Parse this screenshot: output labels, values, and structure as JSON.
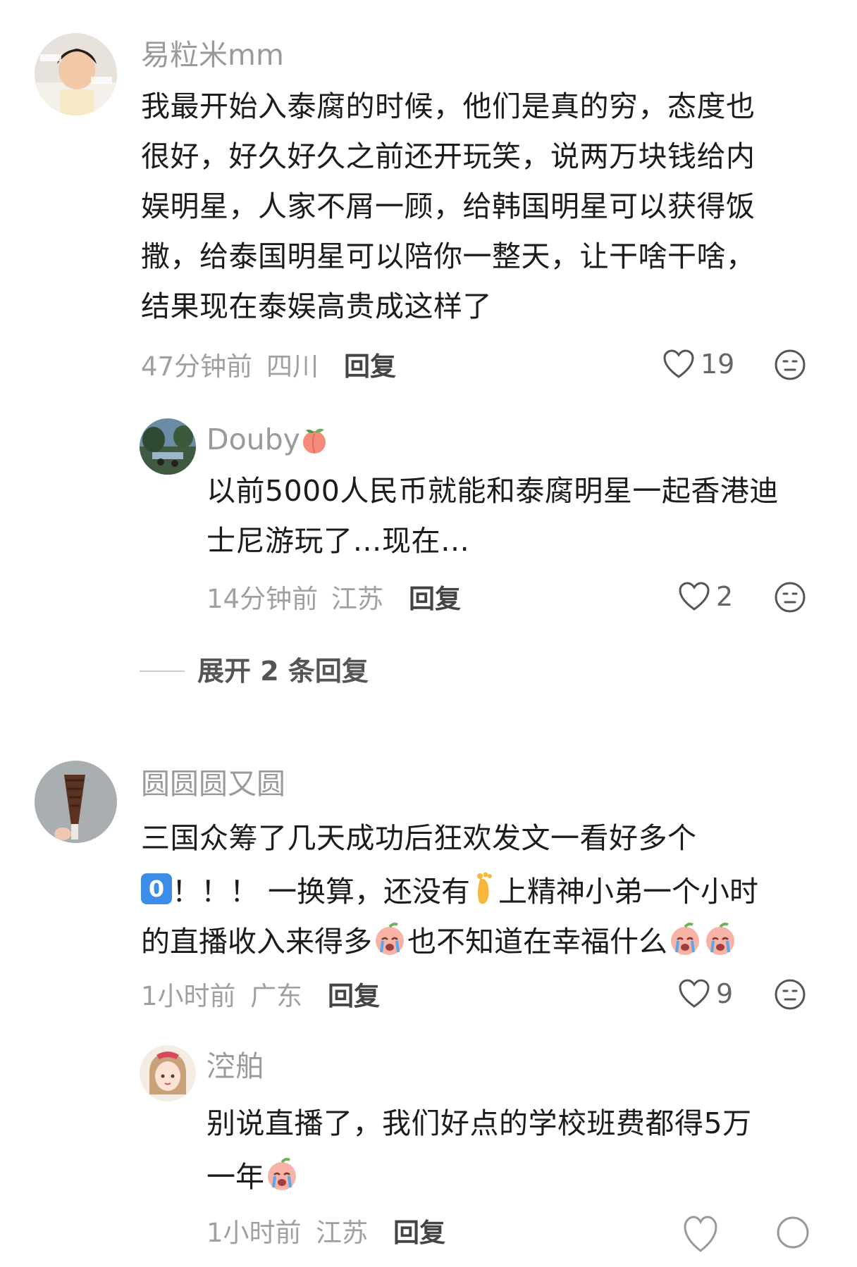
{
  "comments": [
    {
      "username": "易粒米mm",
      "text": "我最开始入泰腐的时候，他们是真的穷，态度也\n很好，好久好久之前还开玩笑，说两万块钱给内\n娱明星，人家不屑一顾，给韩国明星可以获得饭\n撒，给泰国明星可以陪你一整天，让干啥干啥，\n结果现在泰娱高贵成这样了",
      "time": "47分钟前",
      "location": "四川",
      "reply_label": "回复",
      "likes": "19",
      "replies": [
        {
          "username": "Douby",
          "text": "以前5000人民币就能和泰腐明星一起香港迪\n士尼游玩了…现在…",
          "time": "14分钟前",
          "location": "江苏",
          "reply_label": "回复",
          "likes": "2"
        }
      ],
      "expand_label": "展开 2 条回复"
    },
    {
      "username": "圆圆圆又圆",
      "text_line1": "三国众筹了几天成功后狂欢发文一看好多个",
      "text_line2a": "！！！ 一换算，还没有",
      "text_line2b": "上精神小弟一个小时",
      "text_line3": "的直播收入来得多",
      "text_line3b": "也不知道在幸福什么",
      "zero_emoji": "0",
      "time": "1小时前",
      "location": "广东",
      "reply_label": "回复",
      "likes": "9",
      "replies": [
        {
          "username": "涳舶",
          "text_line1": "别说直播了，我们好点的学校班费都得5万",
          "text_line2": "一年",
          "time": "1小时前",
          "location": "江苏",
          "reply_label": "回复"
        }
      ]
    }
  ],
  "colors": {
    "meta_gray": "#a0a0a0",
    "username_gray": "#9a9a9a",
    "text": "#1c1c1c"
  },
  "icons": [
    "heart-outline-icon",
    "neutral-face-icon",
    "crying-face-emoji",
    "foot-emoji",
    "peach-emoji",
    "keycap-zero-emoji"
  ]
}
